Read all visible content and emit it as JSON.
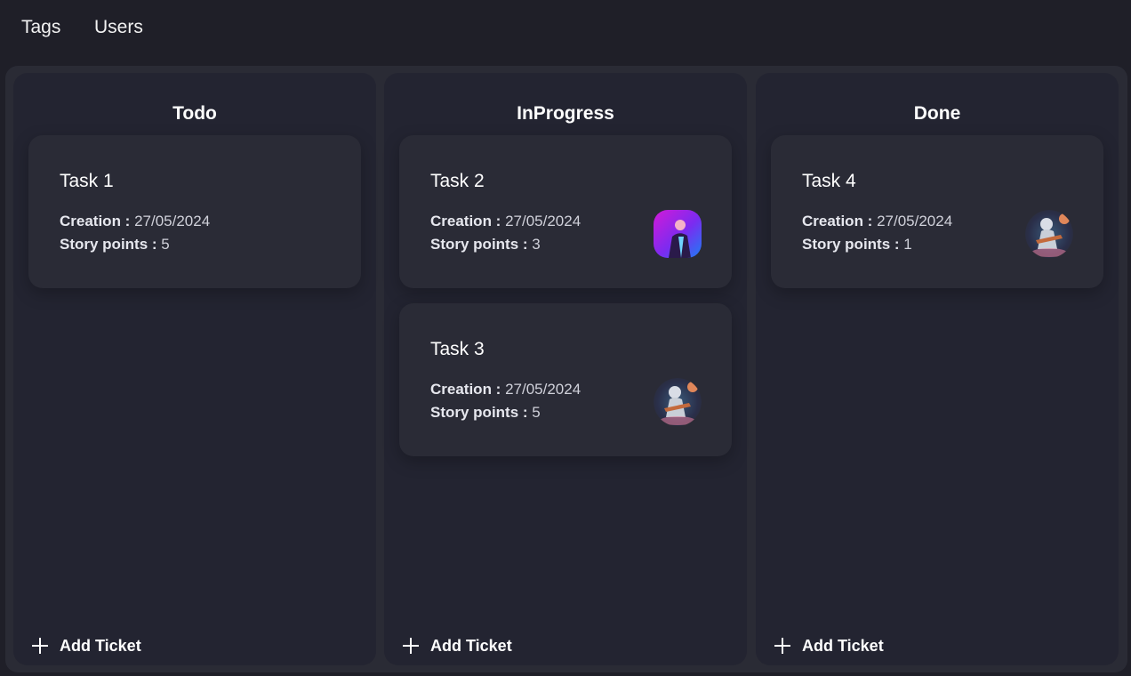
{
  "nav": {
    "tags": "Tags",
    "users": "Users"
  },
  "columns": [
    {
      "title": "Todo",
      "add_label": "Add Ticket",
      "cards": [
        {
          "title": "Task 1",
          "creation_label": "Creation :",
          "creation": "27/05/2024",
          "points_label": "Story points :",
          "points": "5",
          "avatar": "none"
        }
      ]
    },
    {
      "title": "InProgress",
      "add_label": "Add Ticket",
      "cards": [
        {
          "title": "Task 2",
          "creation_label": "Creation :",
          "creation": "27/05/2024",
          "points_label": "Story points :",
          "points": "3",
          "avatar": "avatar-singer-neon"
        },
        {
          "title": "Task 3",
          "creation_label": "Creation :",
          "creation": "27/05/2024",
          "points_label": "Story points :",
          "points": "5",
          "avatar": "avatar-astronaut-guitar"
        }
      ]
    },
    {
      "title": "Done",
      "add_label": "Add Ticket",
      "cards": [
        {
          "title": "Task 4",
          "creation_label": "Creation :",
          "creation": "27/05/2024",
          "points_label": "Story points :",
          "points": "1",
          "avatar": "avatar-astronaut-guitar"
        }
      ]
    }
  ],
  "colors": {
    "background": "#1f1f28",
    "board": "#2a2b35",
    "column": "#232431",
    "card": "#2a2b36"
  }
}
